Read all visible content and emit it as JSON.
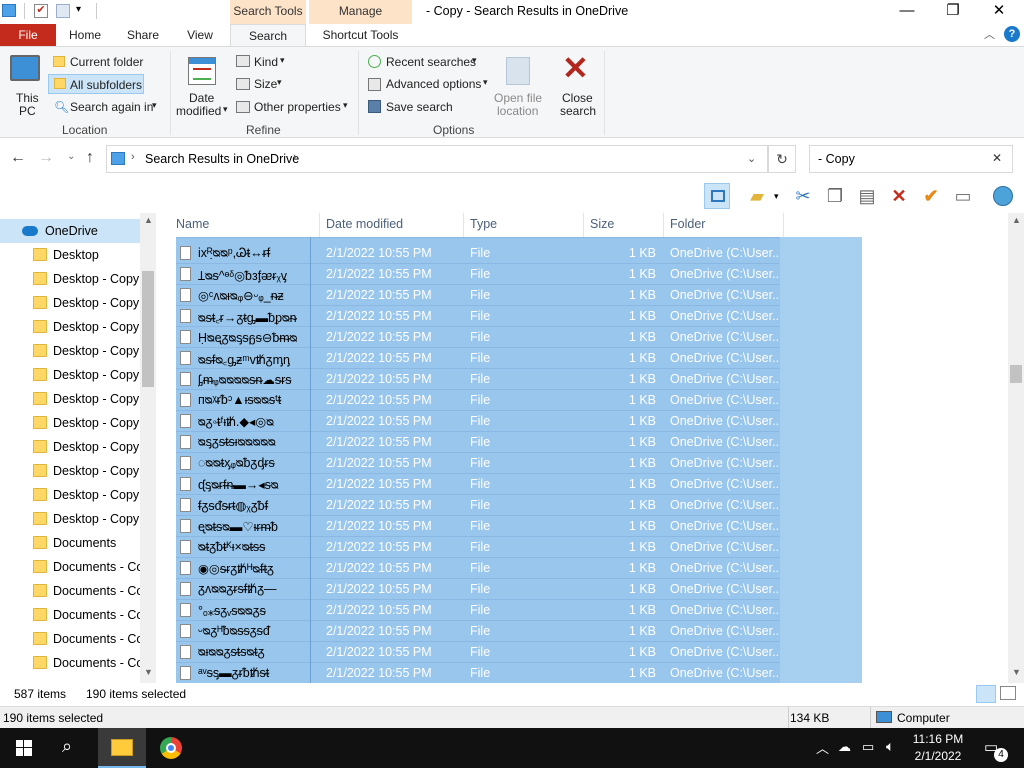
{
  "window": {
    "title": "- Copy - Search Results in OneDrive",
    "context_tab_search_tools": "Search Tools",
    "context_tab_manage": "Manage",
    "minimize": "—",
    "maximize": "❐",
    "close": "✕"
  },
  "ribbon_tabs": [
    "File",
    "Home",
    "Share",
    "View",
    "Search",
    "Shortcut Tools"
  ],
  "ribbon": {
    "location": {
      "this_pc": [
        "This",
        "PC"
      ],
      "current_folder": "Current folder",
      "all_subfolders": "All subfolders",
      "search_again": "Search again in",
      "label": "Location"
    },
    "refine": {
      "date_modified": [
        "Date",
        "modified"
      ],
      "kind": "Kind",
      "size": "Size",
      "other_properties": "Other properties",
      "label": "Refine"
    },
    "options": {
      "recent_searches": "Recent searches",
      "advanced_options": "Advanced options",
      "save_search": "Save search",
      "open_file_location": [
        "Open file",
        "location"
      ],
      "close_search": [
        "Close",
        "search"
      ],
      "label": "Options"
    }
  },
  "address": {
    "path": "Search Results in OneDrive",
    "search_value": "- Copy"
  },
  "nav_pane": {
    "items": [
      "OneDrive",
      "Desktop",
      "Desktop - Copy",
      "Desktop - Copy",
      "Desktop - Copy",
      "Desktop - Copy",
      "Desktop - Copy",
      "Desktop - Copy",
      "Desktop - Copy",
      "Desktop - Copy",
      "Desktop - Copy",
      "Desktop - Copy",
      "Desktop - Copy",
      "Documents",
      "Documents - Co",
      "Documents - Co",
      "Documents - Co",
      "Documents - Co",
      "Documents - Co"
    ]
  },
  "columns": [
    "Name",
    "Date modified",
    "Type",
    "Size",
    "Folder"
  ],
  "rows": [
    {
      "name": "ix݂ᴿᴓᴓᵖ,Ꮚᵵ↔ᵲᵮ",
      "date": "2/1/2022 10:55 PM",
      "type": "File",
      "size": "1 KB",
      "folder": "OneDrive (C:\\User..."
    },
    {
      "name": "Ʇᴓᵴ^ᶱᵟ◎ᵬᴈᶂᴂᵲᵪᶌ",
      "date": "2/1/2022 10:55 PM",
      "type": "File",
      "size": "1 KB",
      "folder": "OneDrive (C:\\User..."
    },
    {
      "name": "◎ᶜᴧᴓᵻᴓᵩ⊖ᵕᵩ_ᵰᵶ",
      "date": "2/1/2022 10:55 PM",
      "type": "File",
      "size": "1 KB",
      "folder": "OneDrive (C:\\User..."
    },
    {
      "name": "ᴓᵴᵵ꜀ᵲ→ᵹᵵᶃ▬ᵬᵱᴓᵰ",
      "date": "2/1/2022 10:55 PM",
      "type": "File",
      "size": "1 KB",
      "folder": "OneDrive (C:\\User..."
    },
    {
      "name": "Ḥᴓᶒᵹᴓᶊᵴᵷᵴ⊖ᵬᵯᴓ",
      "date": "2/1/2022 10:55 PM",
      "type": "File",
      "size": "1 KB",
      "folder": "OneDrive (C:\\User..."
    },
    {
      "name": "ᴓᵴᵮᴓ꜀ᶃᵶᵐᴠᵺᵹᶆᶇ",
      "date": "2/1/2022 10:55 PM",
      "type": "File",
      "size": "1 KB",
      "folder": "OneDrive (C:\\User..."
    },
    {
      "name": "ᶋᵯᵩᴓᴓᴓᴓᵴᵰ☁ᵴᵲᵴ",
      "date": "2/1/2022 10:55 PM",
      "type": "File",
      "size": "1 KB",
      "folder": "OneDrive (C:\\User..."
    },
    {
      "name": "ᴨᴓᵡᵲᵬᵓ▲ᵻᵴᴓᴓᵴᵗᵵ",
      "date": "2/1/2022 10:55 PM",
      "type": "File",
      "size": "1 KB",
      "folder": "OneDrive (C:\\User..."
    },
    {
      "name": "ᴓᵹ◦ᵵᶠᵻᵺ.◆◂◎ᴓ",
      "date": "2/1/2022 10:55 PM",
      "type": "File",
      "size": "1 KB",
      "folder": "OneDrive (C:\\User..."
    },
    {
      "name": "ᴓᶊᵹᵴᵵᵴᵻᴓᴓᴓᴓᴓ",
      "date": "2/1/2022 10:55 PM",
      "type": "File",
      "size": "1 KB",
      "folder": "OneDrive (C:\\User..."
    },
    {
      "name": "◌ᴓᴓᵵᶍᵩᴓᵬᵹᶁᵲᵴ",
      "date": "2/1/2022 10:55 PM",
      "type": "File",
      "size": "1 KB",
      "folder": "OneDrive (C:\\User..."
    },
    {
      "name": "ᶑᶊᴓᵲᵮᵰ▬→◂ᵴᴓ",
      "date": "2/1/2022 10:55 PM",
      "type": "File",
      "size": "1 KB",
      "folder": "OneDrive (C:\\User..."
    },
    {
      "name": "ᵮᵹᵴᵭᵴᵲᵵ◍ᵪᵹᵬᵮ",
      "date": "2/1/2022 10:55 PM",
      "type": "File",
      "size": "1 KB",
      "folder": "OneDrive (C:\\User..."
    },
    {
      "name": "ᶒᴓᵵᵴᴓ▬♡ᵻᵲᵯᵬ",
      "date": "2/1/2022 10:55 PM",
      "type": "File",
      "size": "1 KB",
      "folder": "OneDrive (C:\\User..."
    },
    {
      "name": "ᴓᵵᵹᵬᵵᴷᵻ×ᴓᵵᵴᵴ",
      "date": "2/1/2022 10:55 PM",
      "type": "File",
      "size": "1 KB",
      "folder": "OneDrive (C:\\User..."
    },
    {
      "name": "◉◎ᵴᵲᵹᵺᴴᴓᵮᵵᵹ",
      "date": "2/1/2022 10:55 PM",
      "type": "File",
      "size": "1 KB",
      "folder": "OneDrive (C:\\User..."
    },
    {
      "name": "ᵹᴧᴓᴓᵹᵲᵴᵮᵺᵹ—",
      "date": "2/1/2022 10:55 PM",
      "type": "File",
      "size": "1 KB",
      "folder": "OneDrive (C:\\User..."
    },
    {
      "name": "°ₒ⁎ᵴᵹᵥᵴᴓᴓᵹᵴ",
      "date": "2/1/2022 10:55 PM",
      "type": "File",
      "size": "1 KB",
      "folder": "OneDrive (C:\\User..."
    },
    {
      "name": "ᵕᴓᵹᴴᵬᴓᵴᵴᵹᵴᵭ",
      "date": "2/1/2022 10:55 PM",
      "type": "File",
      "size": "1 KB",
      "folder": "OneDrive (C:\\User..."
    },
    {
      "name": "ᴓᵻᴓᴓᵹᵴᵵᵴᴓᵵᵹ",
      "date": "2/1/2022 10:55 PM",
      "type": "File",
      "size": "1 KB",
      "folder": "OneDrive (C:\\User..."
    },
    {
      "name": "ᵃᵛᵴᶊ▬ᵹᵲᵬᵺᵴᵵ",
      "date": "2/1/2022 10:55 PM",
      "type": "File",
      "size": "1 KB",
      "folder": "OneDrive (C:\\User..."
    }
  ],
  "status": {
    "item_count": "587 items",
    "selected": "190 items selected"
  },
  "details": {
    "selected": "190 items selected",
    "size": "134 KB",
    "location": "Computer"
  },
  "taskbar": {
    "time": "11:16 PM",
    "date": "2/1/2022",
    "notification_count": "4"
  },
  "colors": {
    "accent": "#1979ca",
    "selection": "#99c6ec",
    "file_tab": "#c42b1c",
    "context_tab": "#fde3c8"
  }
}
